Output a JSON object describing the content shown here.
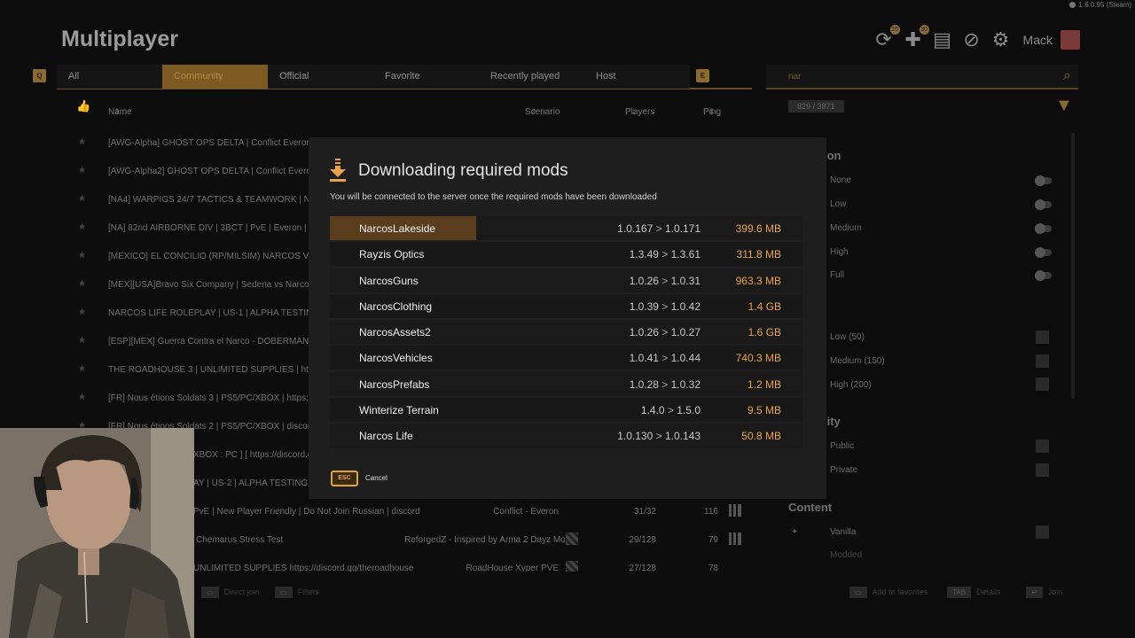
{
  "version": "1.6.0.95 (Steam)",
  "page_title": "Multiplayer",
  "user": {
    "name": "Mack"
  },
  "top_badges": {
    "refresh": "16",
    "mods": "30"
  },
  "tabs": [
    {
      "label": "All",
      "active": false
    },
    {
      "label": "Community",
      "active": true
    },
    {
      "label": "Official",
      "active": false
    },
    {
      "label": "Favorite",
      "active": false
    },
    {
      "label": "Recently played",
      "active": false
    },
    {
      "label": "Host",
      "active": false
    }
  ],
  "keys": {
    "left": "Q",
    "right": "E"
  },
  "columns": {
    "name": "Name",
    "scenario": "Scenario",
    "players": "Players",
    "ping": "Ping"
  },
  "search": {
    "value": "nar",
    "count": "829 / 3871"
  },
  "servers": [
    {
      "name": "[AWG-Alpha] GHOST OPS DELTA | Conflict Everon | PS"
    },
    {
      "name": "[AWG-Alpha2] GHOST OPS DELTA | Conflict Everon | P"
    },
    {
      "name": "[NA4] WARPIGS 24/7 TACTICS & TEAMWORK | NEW P"
    },
    {
      "name": "[NA] 82nd AIRBORNE DIV | 3BCT | PvE | Everon | Pub 3"
    },
    {
      "name": "[MEXICO] EL CONCILIO (RP/MILSIM) NARCOS VS SED"
    },
    {
      "name": "[MEX][USA]Bravo Six Company | Sedena vs Narcos Mil"
    },
    {
      "name": "NARCOS LIFE ROLEPLAY | US-1 | ALPHA TESTING | dis"
    },
    {
      "name": "[ESP][MEX] Guerra Contra el Narco - DOBERMAN #1 - c"
    },
    {
      "name": "THE ROADHOUSE 3 | UNLIMITED SUPPLIES | https://d"
    },
    {
      "name": "[FR] Nous étions Soldats 3 | PS5/PC/XBOX | https://di"
    },
    {
      "name": "[FR] Nous étions Soldats 2 | PS5/PC/XBOX | discord.a"
    },
    {
      "name": "XBOX : PC ] [ https://discord.gg"
    },
    {
      "name": "AY | US-2 | ALPHA TESTING | dis"
    },
    {
      "name": "PvE | New Player Friendly | Do Not Join Russian | discord",
      "scenario": "Conflict - Everon",
      "players": "31/32",
      "ping": "116"
    },
    {
      "name": "Chemarus Stress Test",
      "scenario": "ReforgedZ - Inspired by Arma 2 Dayz Mod",
      "players": "29/128",
      "ping": "79"
    },
    {
      "name": "UNLIMITED SUPPLIES https://discord.gg/theroadhouse",
      "scenario": "RoadHouse Xyper PVE",
      "players": "27/128",
      "ping": "78"
    }
  ],
  "filters": {
    "section1_title": "ion",
    "section1": [
      "None",
      "Low",
      "Medium",
      "High",
      "Full"
    ],
    "section2": [
      "Low (50)",
      "Medium (150)",
      "High (200)"
    ],
    "section3_title": "lity",
    "section3": [
      "Public",
      "Private"
    ],
    "content_title": "Content",
    "content": [
      "Vanilla",
      "Modded"
    ]
  },
  "footer": {
    "direct_join": "Direct join",
    "filters": "Filters",
    "add_favorites": "Add to favorites",
    "tab_key": "TAB",
    "details": "Details",
    "join": "Join"
  },
  "dialog": {
    "title": "Downloading required mods",
    "subtitle": "You will be connected to the server once the required mods have been downloaded",
    "mods": [
      {
        "name": "NarcosLakeside",
        "from": "1.0.167",
        "to": "1.0.171",
        "size": "399.6 MB",
        "progress": 0.31
      },
      {
        "name": "Rayzis Optics",
        "from": "1.3.49",
        "to": "1.3.61",
        "size": "311.8 MB",
        "progress": 0
      },
      {
        "name": "NarcosGuns",
        "from": "1.0.26",
        "to": "1.0.31",
        "size": "963.3 MB",
        "progress": 0
      },
      {
        "name": "NarcosClothing",
        "from": "1.0.39",
        "to": "1.0.42",
        "size": "1.4 GB",
        "progress": 0
      },
      {
        "name": "NarcosAssets2",
        "from": "1.0.26",
        "to": "1.0.27",
        "size": "1.6 GB",
        "progress": 0
      },
      {
        "name": "NarcosVehicles",
        "from": "1.0.41",
        "to": "1.0.44",
        "size": "740.3 MB",
        "progress": 0
      },
      {
        "name": "NarcosPrefabs",
        "from": "1.0.28",
        "to": "1.0.32",
        "size": "1.2 MB",
        "progress": 0
      },
      {
        "name": "Winterize Terrain",
        "from": "1.4.0",
        "to": "1.5.0",
        "size": "9.5 MB",
        "progress": 0
      },
      {
        "name": "Narcos Life",
        "from": "1.0.130",
        "to": "1.0.143",
        "size": "50.8 MB",
        "progress": 0
      }
    ],
    "esc_key": "ESC",
    "cancel_label": "Cancel",
    "accent_color": "#e8a24a"
  }
}
